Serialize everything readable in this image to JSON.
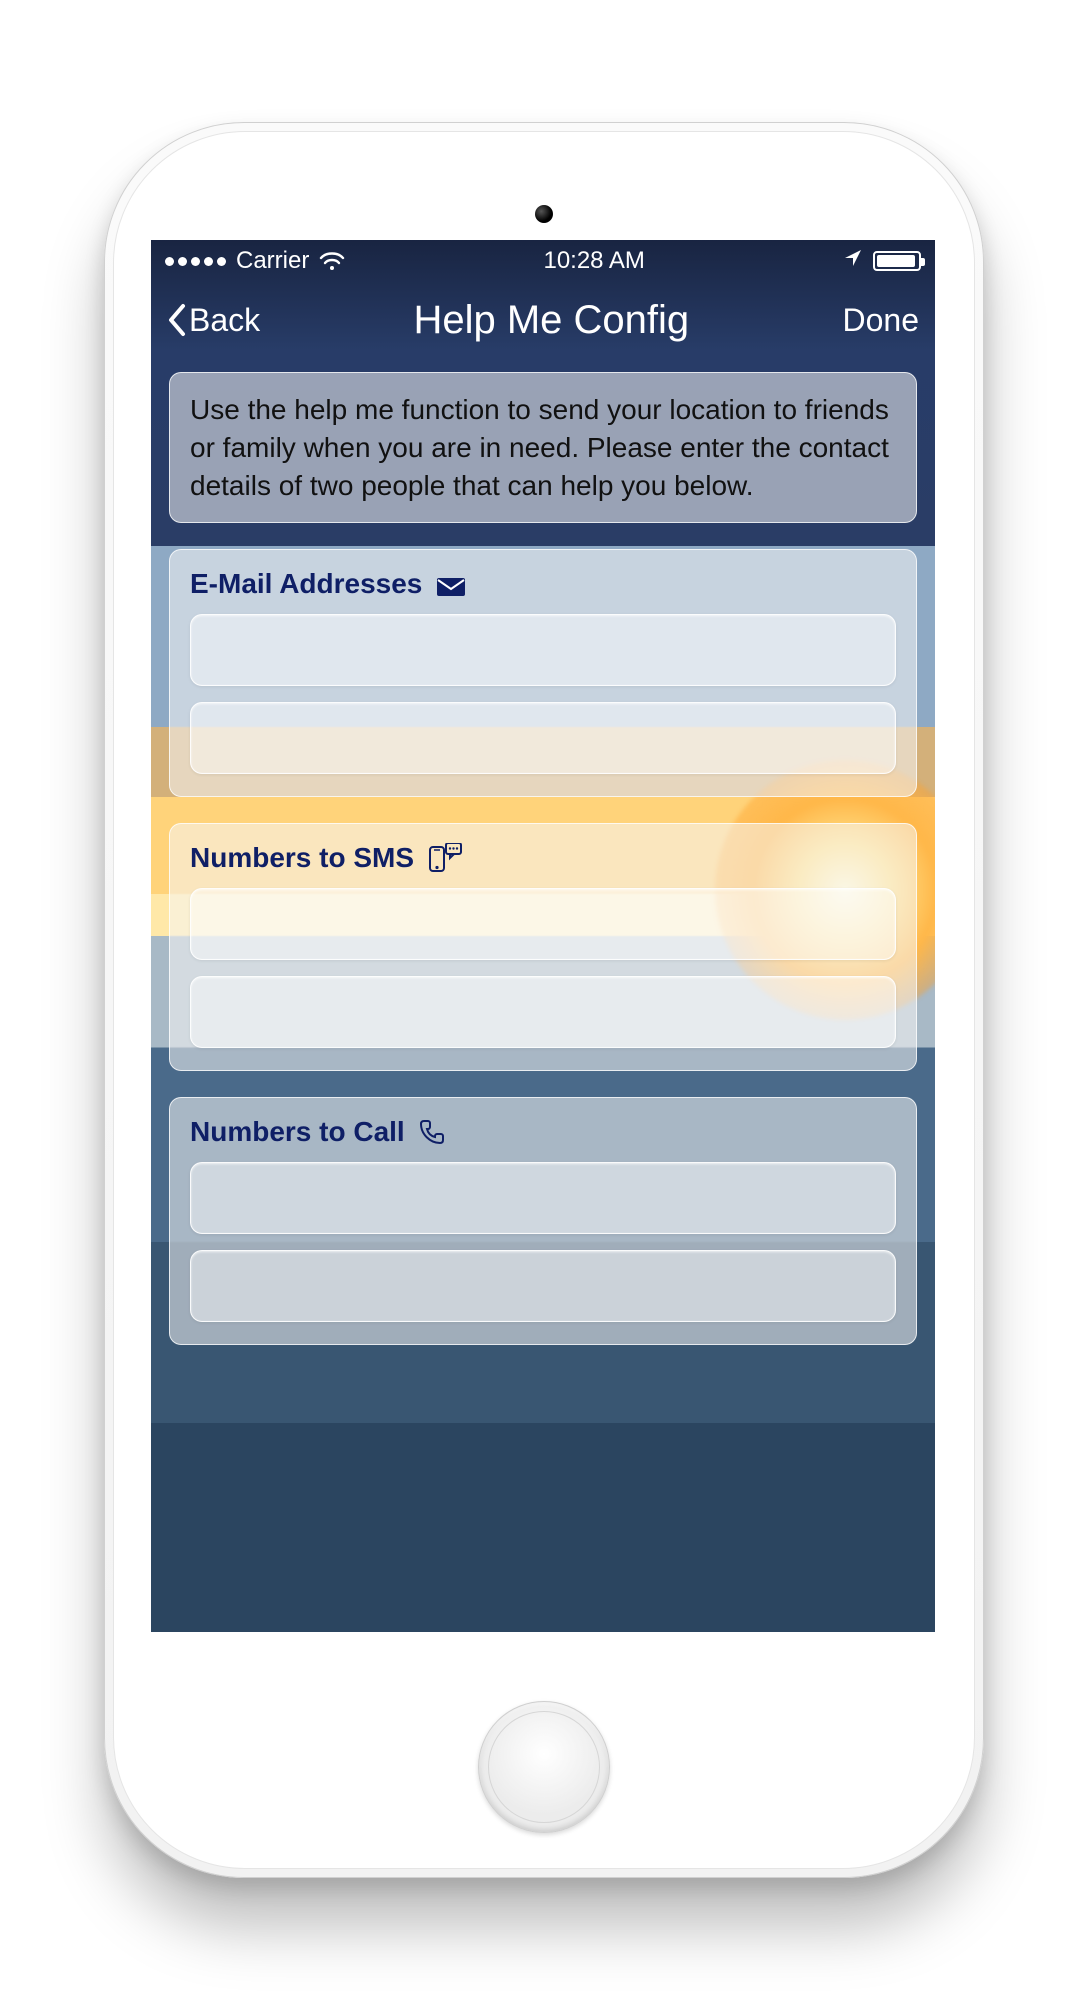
{
  "status_bar": {
    "carrier": "Carrier",
    "time": "10:28 AM"
  },
  "nav": {
    "back_label": "Back",
    "title": "Help Me Config",
    "done_label": "Done"
  },
  "intro": "Use the help me function to send your location to friends or family when you are in need. Please enter the contact details of two people that can help you below.",
  "sections": {
    "email": {
      "title": "E-Mail Addresses",
      "field1": "",
      "field2": ""
    },
    "sms": {
      "title": "Numbers to SMS",
      "field1": "",
      "field2": ""
    },
    "call": {
      "title": "Numbers to Call",
      "field1": "",
      "field2": ""
    }
  },
  "colors": {
    "heading": "#0f1f66"
  }
}
